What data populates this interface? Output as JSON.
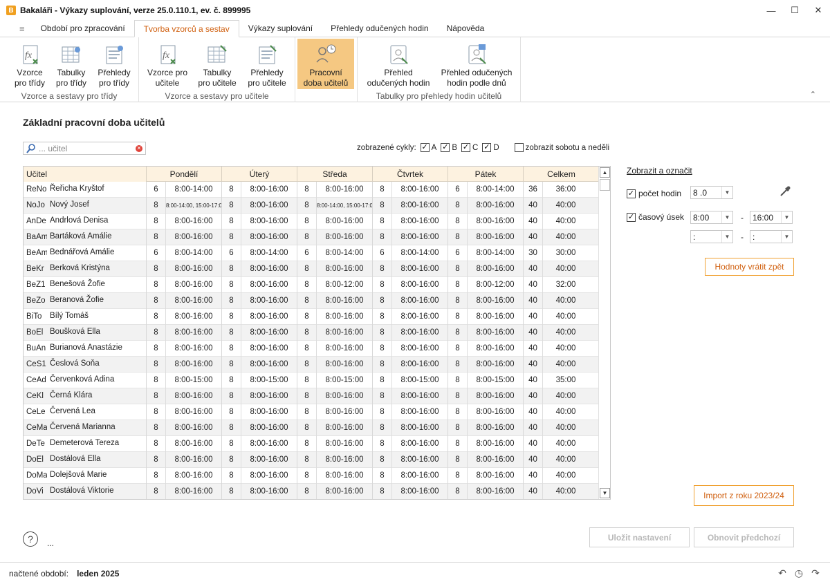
{
  "window": {
    "title": "Bakaláři - Výkazy suplování, verze 25.0.110.1, ev. č. 899995",
    "app_icon": "B"
  },
  "tabs": [
    {
      "label": "="
    },
    {
      "label": "Období pro zpracování"
    },
    {
      "label": "Tvorba vzorců a sestav"
    },
    {
      "label": "Výkazy suplování"
    },
    {
      "label": "Přehledy odučených hodin"
    },
    {
      "label": "Nápověda"
    }
  ],
  "ribbon": {
    "groups": [
      {
        "label": "Vzorce a sestavy pro třídy",
        "buttons": [
          {
            "label": "Vzorce\npro třídy",
            "icon": "formula-class-icon"
          },
          {
            "label": "Tabulky\npro třídy",
            "icon": "table-class-icon"
          },
          {
            "label": "Přehledy\npro třídy",
            "icon": "overview-class-icon"
          }
        ]
      },
      {
        "label": "Vzorce a sestavy pro učitele",
        "buttons": [
          {
            "label": "Vzorce pro\nučitele",
            "icon": "formula-teacher-icon"
          },
          {
            "label": "Tabulky\npro učitele",
            "icon": "table-teacher-icon"
          },
          {
            "label": "Přehledy\npro učitele",
            "icon": "overview-teacher-icon"
          }
        ]
      },
      {
        "label": "",
        "buttons": [
          {
            "label": "Pracovní\ndoba učitelů",
            "icon": "working-hours-icon"
          }
        ]
      },
      {
        "label": "Tabulky pro přehledy hodin učitelů",
        "buttons": [
          {
            "label": "Přehled\nodučených hodin",
            "icon": "taught-hours-icon"
          },
          {
            "label": "Přehled odučených\nhodin podle dnů",
            "icon": "taught-hours-days-icon"
          }
        ]
      }
    ]
  },
  "page": {
    "heading": "Základní pracovní doba učitelů"
  },
  "search": {
    "placeholder": "... učitel"
  },
  "cycles": {
    "label": "zobrazené cykly:",
    "items": [
      "A",
      "B",
      "C",
      "D"
    ],
    "weekend_label": "zobrazit sobotu a neděli"
  },
  "table": {
    "headers": [
      "Učitel",
      "Pondělí",
      "Úterý",
      "Středa",
      "Čtvrtek",
      "Pátek",
      "Celkem"
    ],
    "rows": [
      {
        "abbr": "ReNo",
        "name": "Řeřicha Kryštof",
        "d": [
          [
            "6",
            "8:00-14:00"
          ],
          [
            "8",
            "8:00-16:00"
          ],
          [
            "8",
            "8:00-16:00"
          ],
          [
            "8",
            "8:00-16:00"
          ],
          [
            "6",
            "8:00-14:00"
          ]
        ],
        "tot": [
          "36",
          "36:00"
        ]
      },
      {
        "abbr": "NoJo",
        "name": "Nový Josef",
        "d": [
          [
            "8",
            "8:00-14:00, 15:00-17:00"
          ],
          [
            "8",
            "8:00-16:00"
          ],
          [
            "8",
            "8:00-14:00, 15:00-17:00"
          ],
          [
            "8",
            "8:00-16:00"
          ],
          [
            "8",
            "8:00-16:00"
          ]
        ],
        "tot": [
          "40",
          "40:00"
        ]
      },
      {
        "abbr": "AnDe",
        "name": "Andrlová Denisa",
        "d": [
          [
            "8",
            "8:00-16:00"
          ],
          [
            "8",
            "8:00-16:00"
          ],
          [
            "8",
            "8:00-16:00"
          ],
          [
            "8",
            "8:00-16:00"
          ],
          [
            "8",
            "8:00-16:00"
          ]
        ],
        "tot": [
          "40",
          "40:00"
        ]
      },
      {
        "abbr": "BaAm",
        "name": "Bartáková Amálie",
        "d": [
          [
            "8",
            "8:00-16:00"
          ],
          [
            "8",
            "8:00-16:00"
          ],
          [
            "8",
            "8:00-16:00"
          ],
          [
            "8",
            "8:00-16:00"
          ],
          [
            "8",
            "8:00-16:00"
          ]
        ],
        "tot": [
          "40",
          "40:00"
        ]
      },
      {
        "abbr": "BeAm",
        "name": "Bednářová Amálie",
        "d": [
          [
            "6",
            "8:00-14:00"
          ],
          [
            "6",
            "8:00-14:00"
          ],
          [
            "6",
            "8:00-14:00"
          ],
          [
            "6",
            "8:00-14:00"
          ],
          [
            "6",
            "8:00-14:00"
          ]
        ],
        "tot": [
          "30",
          "30:00"
        ]
      },
      {
        "abbr": "BeKr",
        "name": "Berková Kristýna",
        "d": [
          [
            "8",
            "8:00-16:00"
          ],
          [
            "8",
            "8:00-16:00"
          ],
          [
            "8",
            "8:00-16:00"
          ],
          [
            "8",
            "8:00-16:00"
          ],
          [
            "8",
            "8:00-16:00"
          ]
        ],
        "tot": [
          "40",
          "40:00"
        ]
      },
      {
        "abbr": "BeŽ1",
        "name": "Benešová Žofie",
        "d": [
          [
            "8",
            "8:00-16:00"
          ],
          [
            "8",
            "8:00-16:00"
          ],
          [
            "8",
            "8:00-12:00"
          ],
          [
            "8",
            "8:00-16:00"
          ],
          [
            "8",
            "8:00-12:00"
          ]
        ],
        "tot": [
          "40",
          "32:00"
        ]
      },
      {
        "abbr": "BeŽo",
        "name": "Beranová Žofie",
        "d": [
          [
            "8",
            "8:00-16:00"
          ],
          [
            "8",
            "8:00-16:00"
          ],
          [
            "8",
            "8:00-16:00"
          ],
          [
            "8",
            "8:00-16:00"
          ],
          [
            "8",
            "8:00-16:00"
          ]
        ],
        "tot": [
          "40",
          "40:00"
        ]
      },
      {
        "abbr": "BiTo",
        "name": "Bílý Tomáš",
        "d": [
          [
            "8",
            "8:00-16:00"
          ],
          [
            "8",
            "8:00-16:00"
          ],
          [
            "8",
            "8:00-16:00"
          ],
          [
            "8",
            "8:00-16:00"
          ],
          [
            "8",
            "8:00-16:00"
          ]
        ],
        "tot": [
          "40",
          "40:00"
        ]
      },
      {
        "abbr": "BoEl",
        "name": "Boušková Ella",
        "d": [
          [
            "8",
            "8:00-16:00"
          ],
          [
            "8",
            "8:00-16:00"
          ],
          [
            "8",
            "8:00-16:00"
          ],
          [
            "8",
            "8:00-16:00"
          ],
          [
            "8",
            "8:00-16:00"
          ]
        ],
        "tot": [
          "40",
          "40:00"
        ]
      },
      {
        "abbr": "BuAn",
        "name": "Burianová Anastázie",
        "d": [
          [
            "8",
            "8:00-16:00"
          ],
          [
            "8",
            "8:00-16:00"
          ],
          [
            "8",
            "8:00-16:00"
          ],
          [
            "8",
            "8:00-16:00"
          ],
          [
            "8",
            "8:00-16:00"
          ]
        ],
        "tot": [
          "40",
          "40:00"
        ]
      },
      {
        "abbr": "CeS1",
        "name": "Česlová Soňa",
        "d": [
          [
            "8",
            "8:00-16:00"
          ],
          [
            "8",
            "8:00-16:00"
          ],
          [
            "8",
            "8:00-16:00"
          ],
          [
            "8",
            "8:00-16:00"
          ],
          [
            "8",
            "8:00-16:00"
          ]
        ],
        "tot": [
          "40",
          "40:00"
        ]
      },
      {
        "abbr": "ČeAd",
        "name": "Červenková Adina",
        "d": [
          [
            "8",
            "8:00-15:00"
          ],
          [
            "8",
            "8:00-15:00"
          ],
          [
            "8",
            "8:00-15:00"
          ],
          [
            "8",
            "8:00-15:00"
          ],
          [
            "8",
            "8:00-15:00"
          ]
        ],
        "tot": [
          "40",
          "35:00"
        ]
      },
      {
        "abbr": "ČeKl",
        "name": "Černá Klára",
        "d": [
          [
            "8",
            "8:00-16:00"
          ],
          [
            "8",
            "8:00-16:00"
          ],
          [
            "8",
            "8:00-16:00"
          ],
          [
            "8",
            "8:00-16:00"
          ],
          [
            "8",
            "8:00-16:00"
          ]
        ],
        "tot": [
          "40",
          "40:00"
        ]
      },
      {
        "abbr": "ČeLe",
        "name": "Červená Lea",
        "d": [
          [
            "8",
            "8:00-16:00"
          ],
          [
            "8",
            "8:00-16:00"
          ],
          [
            "8",
            "8:00-16:00"
          ],
          [
            "8",
            "8:00-16:00"
          ],
          [
            "8",
            "8:00-16:00"
          ]
        ],
        "tot": [
          "40",
          "40:00"
        ]
      },
      {
        "abbr": "ČeMa",
        "name": "Červená Marianna",
        "d": [
          [
            "8",
            "8:00-16:00"
          ],
          [
            "8",
            "8:00-16:00"
          ],
          [
            "8",
            "8:00-16:00"
          ],
          [
            "8",
            "8:00-16:00"
          ],
          [
            "8",
            "8:00-16:00"
          ]
        ],
        "tot": [
          "40",
          "40:00"
        ]
      },
      {
        "abbr": "DeTe",
        "name": "Demeterová Tereza",
        "d": [
          [
            "8",
            "8:00-16:00"
          ],
          [
            "8",
            "8:00-16:00"
          ],
          [
            "8",
            "8:00-16:00"
          ],
          [
            "8",
            "8:00-16:00"
          ],
          [
            "8",
            "8:00-16:00"
          ]
        ],
        "tot": [
          "40",
          "40:00"
        ]
      },
      {
        "abbr": "DoEl",
        "name": "Dostálová Ella",
        "d": [
          [
            "8",
            "8:00-16:00"
          ],
          [
            "8",
            "8:00-16:00"
          ],
          [
            "8",
            "8:00-16:00"
          ],
          [
            "8",
            "8:00-16:00"
          ],
          [
            "8",
            "8:00-16:00"
          ]
        ],
        "tot": [
          "40",
          "40:00"
        ]
      },
      {
        "abbr": "DoMa",
        "name": "Dolejšová Marie",
        "d": [
          [
            "8",
            "8:00-16:00"
          ],
          [
            "8",
            "8:00-16:00"
          ],
          [
            "8",
            "8:00-16:00"
          ],
          [
            "8",
            "8:00-16:00"
          ],
          [
            "8",
            "8:00-16:00"
          ]
        ],
        "tot": [
          "40",
          "40:00"
        ]
      },
      {
        "abbr": "DoVi",
        "name": "Dostálová Viktorie",
        "d": [
          [
            "8",
            "8:00-16:00"
          ],
          [
            "8",
            "8:00-16:00"
          ],
          [
            "8",
            "8:00-16:00"
          ],
          [
            "8",
            "8:00-16:00"
          ],
          [
            "8",
            "8:00-16:00"
          ]
        ],
        "tot": [
          "40",
          "40:00"
        ]
      }
    ]
  },
  "side": {
    "link": "Zobrazit a označit",
    "hours_label": "počet hodin",
    "hours_value": "8 .0",
    "time_label": "časový úsek",
    "time_from": "8:00",
    "time_to": "16:00",
    "time2_from": ":",
    "time2_to": ":",
    "dash": "-",
    "reset_button": "Hodnoty vrátit zpět",
    "import_button": "Import z roku 2023/24"
  },
  "footer": {
    "save_button": "Uložit nastavení",
    "restore_button": "Obnovit předchozí",
    "help": "?",
    "ellipsis": "..."
  },
  "status": {
    "label": "načtené období:",
    "value": "leden 2025"
  },
  "colors": {
    "accent": "#d06010",
    "selected": "#f5c882",
    "header_bg": "#fdf2e0"
  }
}
